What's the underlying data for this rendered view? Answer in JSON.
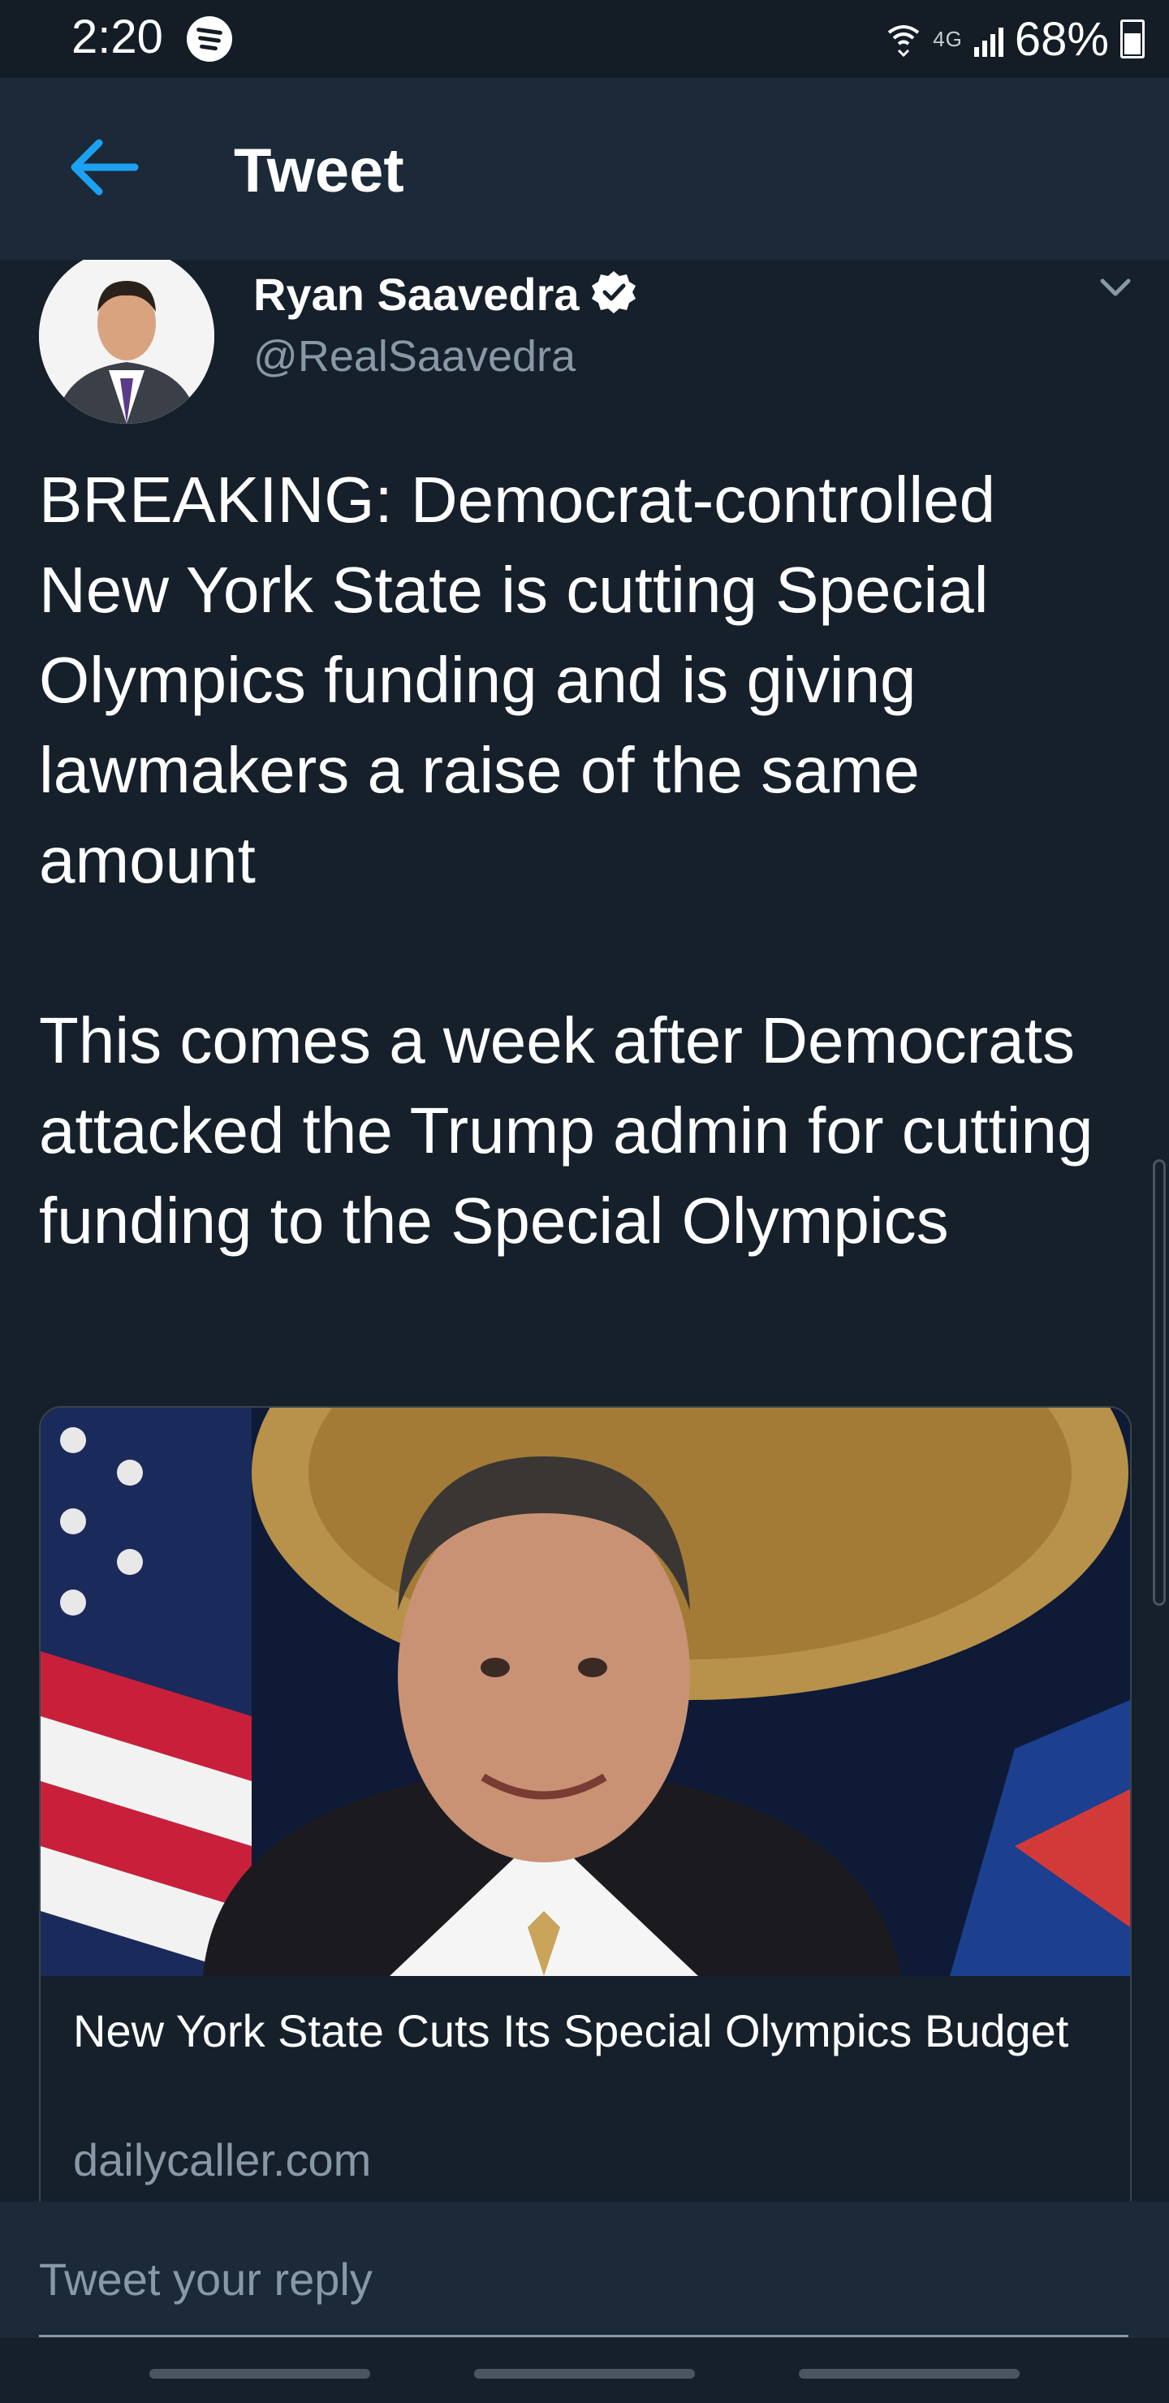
{
  "status_bar": {
    "time": "2:20",
    "network": "4G",
    "battery": "68%",
    "icons": [
      "spotify-icon",
      "wifi-icon",
      "signal-icon",
      "battery-icon"
    ]
  },
  "header": {
    "title": "Tweet",
    "back_icon": "back-arrow-icon",
    "accent_color": "#1da1f2"
  },
  "tweet": {
    "author_name": "Ryan Saavedra",
    "author_handle": "@RealSaavedra",
    "verified": true,
    "text": "BREAKING: Democrat-controlled New York State is cutting Special Olympics funding and is giving lawmakers a raise of the same amount\n\nThis comes a week after Democrats attacked the Trump admin for cutting funding to the Special Olympics",
    "card": {
      "title": "New York State Cuts Its Special Olympics Budget",
      "domain": "dailycaller.com"
    }
  },
  "reply": {
    "placeholder": "Tweet your reply"
  },
  "theme": {
    "background": "#15202b",
    "bar": "#1c2938",
    "secondary_text": "#8899a6"
  }
}
